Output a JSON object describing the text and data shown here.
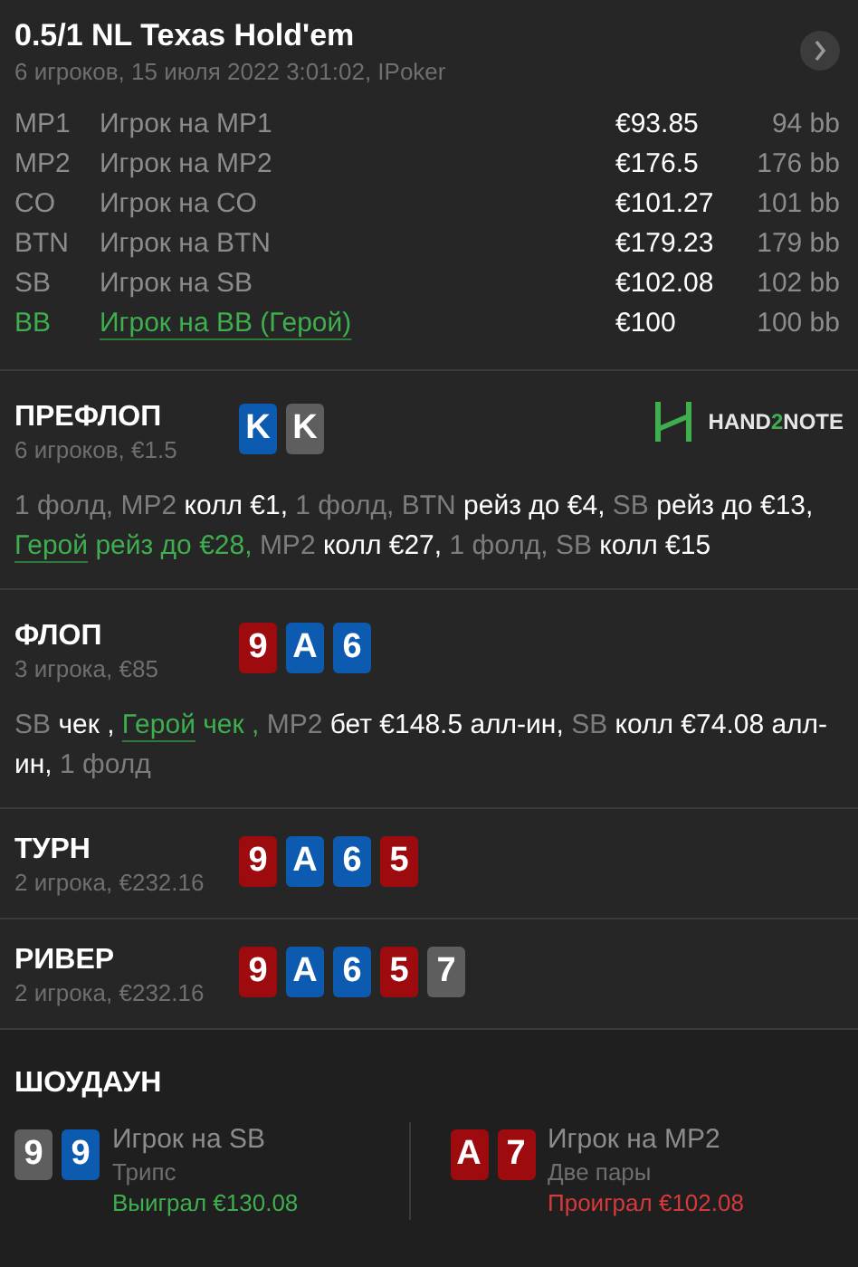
{
  "header": {
    "title": "0.5/1 NL Texas Hold'em",
    "subtitle": "6 игроков, 15 июля 2022 3:01:02, IPoker"
  },
  "players": [
    {
      "position": "MP1",
      "name": "Игрок на MP1",
      "stack": "€93.85",
      "bb": "94 bb",
      "hero": false
    },
    {
      "position": "MP2",
      "name": "Игрок на MP2",
      "stack": "€176.5",
      "bb": "176 bb",
      "hero": false
    },
    {
      "position": "CO",
      "name": "Игрок на CO",
      "stack": "€101.27",
      "bb": "101 bb",
      "hero": false
    },
    {
      "position": "BTN",
      "name": "Игрок на BTN",
      "stack": "€179.23",
      "bb": "179 bb",
      "hero": false
    },
    {
      "position": "SB",
      "name": "Игрок на SB",
      "stack": "€102.08",
      "bb": "102 bb",
      "hero": false
    },
    {
      "position": "BB",
      "name": "Игрок на BB (Герой)",
      "stack": "€100",
      "bb": "100 bb",
      "hero": true
    }
  ],
  "streets": [
    {
      "title": "ПРЕФЛОП",
      "info": "6 игроков, €1.5",
      "cards": [
        {
          "rank": "K",
          "color": "#0d5bb0"
        },
        {
          "rank": "K",
          "color": "#5e5e5e"
        }
      ],
      "logo": {
        "before": "HAND",
        "accent": "2",
        "after": "NOTE"
      },
      "actions": [
        {
          "kind": "muted",
          "text": "1 фолд, MP2 "
        },
        {
          "kind": "bright",
          "text": "колл €1, "
        },
        {
          "kind": "muted",
          "text": "1 фолд, BTN "
        },
        {
          "kind": "bright",
          "text": "рейз до €4, "
        },
        {
          "kind": "muted",
          "text": "SB "
        },
        {
          "kind": "bright",
          "text": "рейз до €13, "
        },
        {
          "kind": "herolink",
          "text": "Герой"
        },
        {
          "kind": "hero",
          "text": " рейз до €28, "
        },
        {
          "kind": "muted",
          "text": "MP2 "
        },
        {
          "kind": "bright",
          "text": "колл €27, "
        },
        {
          "kind": "muted",
          "text": "1 фолд, SB "
        },
        {
          "kind": "bright",
          "text": "колл €15"
        }
      ]
    },
    {
      "title": "ФЛОП",
      "info": "3 игрока, €85",
      "cards": [
        {
          "rank": "9",
          "color": "#9e0b0f"
        },
        {
          "rank": "A",
          "color": "#0d5bb0"
        },
        {
          "rank": "6",
          "color": "#0d5bb0"
        }
      ],
      "actions": [
        {
          "kind": "muted",
          "text": "SB "
        },
        {
          "kind": "bright",
          "text": "чек , "
        },
        {
          "kind": "herolink",
          "text": "Герой"
        },
        {
          "kind": "hero",
          "text": " чек , "
        },
        {
          "kind": "muted",
          "text": "MP2 "
        },
        {
          "kind": "bright",
          "text": "бет €148.5 алл-ин, "
        },
        {
          "kind": "muted",
          "text": "SB "
        },
        {
          "kind": "bright",
          "text": "колл €74.08 алл-ин, "
        },
        {
          "kind": "muted",
          "text": "1 фолд"
        }
      ]
    },
    {
      "title": "ТУРН",
      "info": "2 игрока, €232.16",
      "cards": [
        {
          "rank": "9",
          "color": "#9e0b0f"
        },
        {
          "rank": "A",
          "color": "#0d5bb0"
        },
        {
          "rank": "6",
          "color": "#0d5bb0"
        },
        {
          "rank": "5",
          "color": "#9e0b0f"
        }
      ]
    },
    {
      "title": "РИВЕР",
      "info": "2 игрока, €232.16",
      "cards": [
        {
          "rank": "9",
          "color": "#9e0b0f"
        },
        {
          "rank": "A",
          "color": "#0d5bb0"
        },
        {
          "rank": "6",
          "color": "#0d5bb0"
        },
        {
          "rank": "5",
          "color": "#9e0b0f"
        },
        {
          "rank": "7",
          "color": "#5e5e5e"
        }
      ]
    }
  ],
  "showdown": {
    "title": "ШОУДАУН",
    "hands": [
      {
        "cards": [
          {
            "rank": "9",
            "color": "#5e5e5e"
          },
          {
            "rank": "9",
            "color": "#0d5bb0"
          }
        ],
        "player": "Игрок на SB",
        "combo": "Трипс",
        "result": "Выиграл €130.08",
        "won": true
      },
      {
        "cards": [
          {
            "rank": "A",
            "color": "#9e0b0f"
          },
          {
            "rank": "7",
            "color": "#9e0b0f"
          }
        ],
        "player": "Игрок на MP2",
        "combo": "Две пары",
        "result": "Проиграл €102.08",
        "won": false
      }
    ]
  }
}
